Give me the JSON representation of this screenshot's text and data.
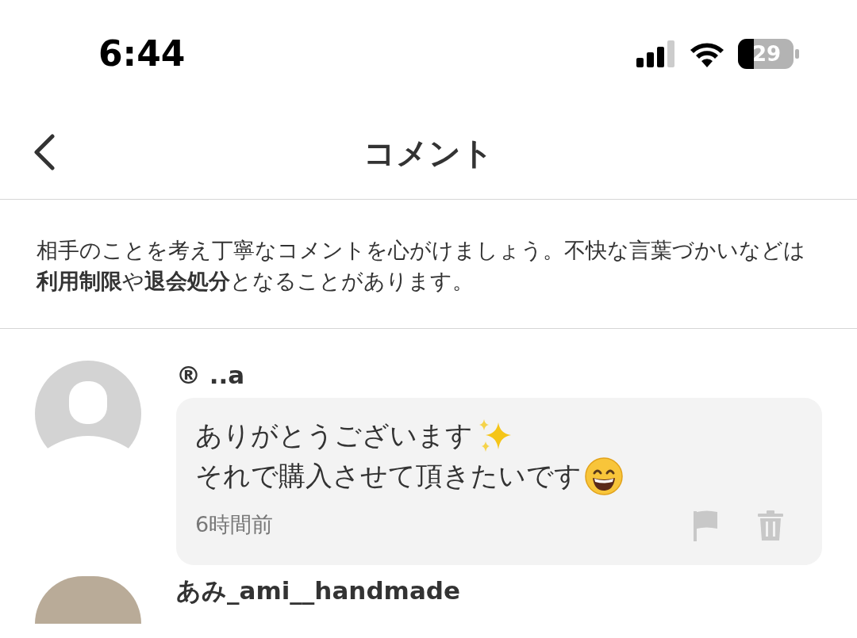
{
  "status_bar": {
    "time": "6:44",
    "battery": "29"
  },
  "header": {
    "title": "コメント"
  },
  "notice": "相手のことを考え丁寧なコメントを心がけましょう。不快な言葉づかいなどは**利用制限**や**退会処分**となることがあります。",
  "comments": [
    {
      "user": "® ..a",
      "lines": [
        {
          "text": "ありがとうございます",
          "kind": "sparkles"
        },
        {
          "text": "それで購入させて頂きたいです",
          "kind": "grin"
        }
      ],
      "time": "6時間前",
      "kind": "default"
    },
    {
      "user": "あみ_ami__handmade",
      "kind": "photo"
    }
  ]
}
